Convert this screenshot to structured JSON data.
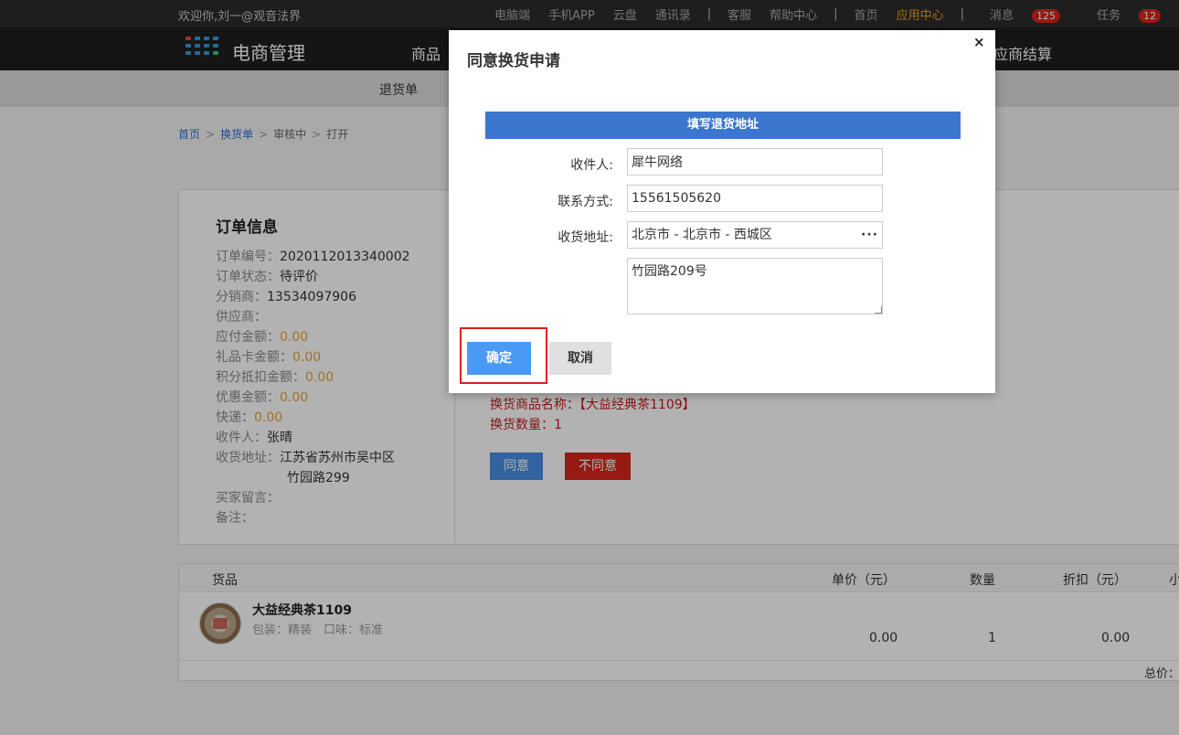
{
  "topbar": {
    "welcome": "欢迎你,刘一@观音法界",
    "links": [
      "电脑端",
      "手机APP",
      "云盘",
      "通讯录",
      "客服",
      "帮助中心",
      "首页",
      "应用中心",
      "消息",
      "任务"
    ],
    "messages_count": "125",
    "tasks_count": "12"
  },
  "header": {
    "app_title": "电商管理",
    "nav_products": "商品",
    "nav_settlement": "应商结算"
  },
  "subnav": {
    "item": "退货单"
  },
  "breadcrumb": {
    "home": "首页",
    "exchange": "换货单",
    "reviewing": "审核中",
    "open": "打开"
  },
  "order": {
    "title": "订单信息",
    "order_no_label": "订单编号：",
    "order_no": "2020112013340002",
    "status_label": "订单状态：",
    "status": "待评价",
    "distributor_label": "分销商：",
    "distributor": "13534097906",
    "supplier_label": "供应商：",
    "payable_label": "应付金额：",
    "payable": "0.00",
    "giftcard_label": "礼品卡金额：",
    "giftcard": "0.00",
    "points_label": "积分抵扣金额：",
    "points": "0.00",
    "discount_label": "优惠金额：",
    "discount": "0.00",
    "express_label": "快递：",
    "express": "0.00",
    "receiver_label": "收件人：",
    "receiver": "张晴",
    "address_label": "收货地址：",
    "address_line1": "江苏省苏州市吴中区",
    "address_line2": "竹园路299",
    "buyer_note_label": "买家留言：",
    "remark_label": "备注："
  },
  "exchange": {
    "goods_name_label": "换货商品名称：",
    "goods_name": "【大益经典茶1109】",
    "qty_label": "换货数量：",
    "qty": "1",
    "agree": "同意",
    "disagree": "不同意"
  },
  "goods": {
    "col_goods": "货品",
    "col_price": "单价（元）",
    "col_qty": "数量",
    "col_discount": "折扣（元）",
    "col_subtotal": "小",
    "name": "大益经典茶1109",
    "spec": "包装：精装　口味：标准",
    "price": "0.00",
    "qty": "1",
    "discount": "0.00",
    "total_label": "总价："
  },
  "modal": {
    "title": "同意换货申请",
    "close": "×",
    "band": "填写退货地址",
    "receiver_label": "收件人:",
    "receiver": "犀牛网络",
    "contact_label": "联系方式:",
    "contact": "15561505620",
    "address_label": "收货地址:",
    "region": "北京市 - 北京市 - 西城区",
    "detail_address": "竹园路209号",
    "ok": "确定",
    "cancel": "取消"
  },
  "colors": {
    "accent_blue": "#3b76cf",
    "danger_red": "#d9251c",
    "highlight_red": "#e0201c",
    "money_orange": "#e8a33b"
  }
}
